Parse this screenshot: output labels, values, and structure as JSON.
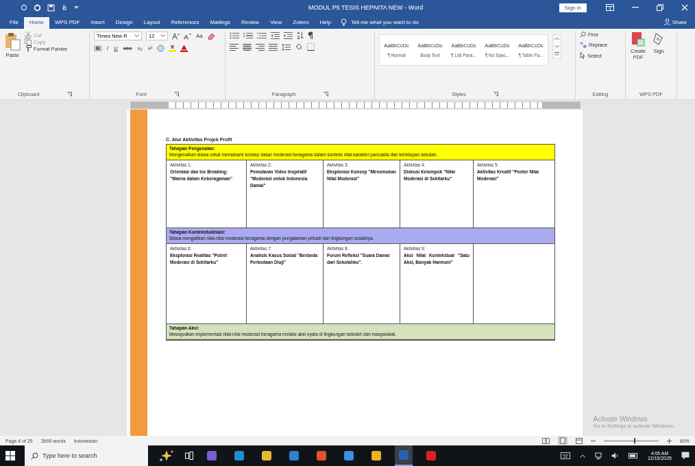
{
  "window": {
    "title": "MODUL P5 TESIS HEPNITA NEW - Word",
    "sign_in": "Sign in"
  },
  "tabs": [
    {
      "label": "File",
      "selected": false
    },
    {
      "label": "Home",
      "selected": true
    },
    {
      "label": "WPS PDF",
      "selected": false
    },
    {
      "label": "Insert",
      "selected": false
    },
    {
      "label": "Design",
      "selected": false
    },
    {
      "label": "Layout",
      "selected": false
    },
    {
      "label": "References",
      "selected": false
    },
    {
      "label": "Mailings",
      "selected": false
    },
    {
      "label": "Review",
      "selected": false
    },
    {
      "label": "View",
      "selected": false
    },
    {
      "label": "Zotero",
      "selected": false
    },
    {
      "label": "Help",
      "selected": false
    }
  ],
  "tell_me": {
    "placeholder": "Tell me what you want to do"
  },
  "share": "Share",
  "clipboard": {
    "paste": "Paste",
    "cut": "Cut",
    "copy": "Copy",
    "format_painter": "Format Painter",
    "label": "Clipboard"
  },
  "font": {
    "name": "Times New R",
    "size": "12",
    "change_case": "Aa",
    "format_buttons": [
      "B",
      "I",
      "U",
      "abc",
      "x₂",
      "x²"
    ],
    "label": "Font"
  },
  "paragraph": {
    "label": "Paragraph"
  },
  "styles": {
    "items": [
      {
        "sample": "AaBbCcDc",
        "name": "¶ Normal"
      },
      {
        "sample": "AaBbCcDc",
        "name": "Body Text"
      },
      {
        "sample": "AaBbCcDc",
        "name": "¶ List Para..."
      },
      {
        "sample": "AaBbCcDc",
        "name": "¶ No Spac..."
      },
      {
        "sample": "AaBbCcDc",
        "name": "¶ Table Pa..."
      }
    ],
    "label": "Styles"
  },
  "editing": {
    "find": "Find",
    "replace": "Replace",
    "select": "Select",
    "label": "Editing"
  },
  "wps_pdf": {
    "create": "Create PDF",
    "sign": "Sign",
    "label": "WPS PDF"
  },
  "document": {
    "heading": "C.  Alur Aktivitas Projek Profil",
    "rows": [
      {
        "kind": "stage",
        "color": "#ffff00",
        "title": "Tahapan Pengenalan:",
        "description": "Mengenalkan siswa untuk memahami konsep dasar moderasi beragama dalam konteks nilai karakter pancasila dan kehidupan sekolah."
      },
      {
        "kind": "activities",
        "cells": [
          {
            "label": "Aktivitas 1:",
            "title": "Orientasi dan Ice Breaking: \"Warna dalam Keberagaman\""
          },
          {
            "label": "Aktivitas 2:",
            "title": "Pemutaran Video Inspiratif \"Moderasi untuk Indonesia Damai\""
          },
          {
            "label": "Aktivitas 3:",
            "title": "Eksplorasi Konsep \"Menemukan Nilai Moderasi\""
          },
          {
            "label": "Aktivitas 4:",
            "title": "Diskusi Kelompok \"Nilai Moderasi di Sekitarku\""
          },
          {
            "label": "Aktivitas 5:",
            "title": "Aktivitas Kreatif \"Poster Nilai Moderasi\""
          }
        ]
      },
      {
        "kind": "stage",
        "color": "#aaaaee",
        "title": "Tahapan Kontekstualisasi:",
        "description": "Siswa mengaitkan nilai-nilai moderasi beragama dengan pengalaman pribadi dan lingkungan sosialnya."
      },
      {
        "kind": "activities",
        "cells": [
          {
            "label": "Aktivitas 6:",
            "title": "Eksplorasi Realitas \"Potret Moderasi di Sekitarku\""
          },
          {
            "label": "Aktivitas 7:",
            "title": "Analisis Kasus Sosial \"Berbeda Perbedaan Diuji\""
          },
          {
            "label": "Aktivitas 8:",
            "title": "Forum Refleksi \"Suara Damai dari Sekolahku\"."
          },
          {
            "label": "Aktivitas 9:",
            "title": "Aksi Nilai Kontekstual \"Satu Aksi, Banyak Harmoni\""
          }
        ]
      },
      {
        "kind": "stage",
        "color": "#d3e2bb",
        "title": "Tahapan Aksi:",
        "description": "Mewujudkan implementasi nilai-nilai moderasi beragama melalui aksi nyata di lingkungan sekolah dan masyarakat."
      }
    ]
  },
  "activation": {
    "title": "Activate Windows",
    "hint": "Go to Settings to activate Windows."
  },
  "status_bar": {
    "page": "Page 4 of 25",
    "words": "3995 words",
    "language": "Indonesian",
    "zoom": {
      "level": 0.55,
      "reading": "60%"
    }
  },
  "taskbar": {
    "search": {
      "placeholder": "Type here to search"
    },
    "apps": [
      {
        "color": "#7b5cd6",
        "selected": false
      },
      {
        "color": "#1e8fd6",
        "selected": false
      },
      {
        "color": "#e8b930",
        "selected": false
      },
      {
        "color": "#2f7fd0",
        "selected": false
      },
      {
        "color": "#e2522b",
        "selected": false
      },
      {
        "color": "#3a8ee6",
        "selected": false
      },
      {
        "color": "#f2b01e",
        "selected": false
      },
      {
        "color": "#2b5fb4",
        "selected": true
      },
      {
        "color": "#d8231f",
        "selected": false
      }
    ],
    "time": "4:05 AM",
    "date": "12/15/2025"
  }
}
